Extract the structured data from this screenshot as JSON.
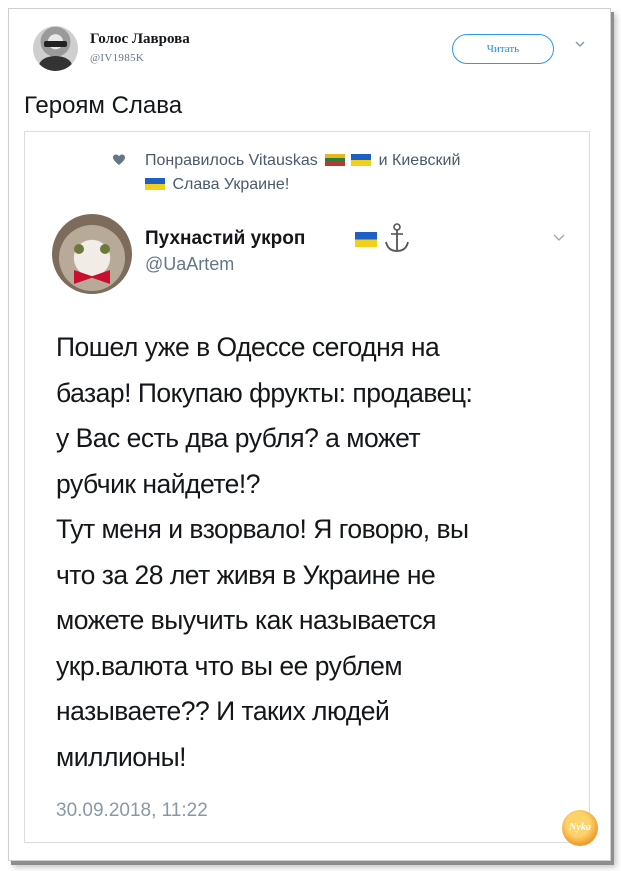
{
  "tweet": {
    "author_name": "Голос Лаврова",
    "author_handle": "@IV1985K",
    "follow_label": "Читать",
    "text": "Героям Слава"
  },
  "quoted": {
    "liked_line1_prefix": "Понравилось Vitauskas",
    "liked_line1_suffix": "и Киевский",
    "liked_line2": "Слава Украине!",
    "author_name": "Пухнастий укроп",
    "author_handle": "@UaArtem",
    "body": "Пошел уже в Одессе сегодня на\nбазар! Покупаю фрукты: продавец:\nу Вас есть два рубля? а может\nрубчик найдете!?\n  Тут меня и взорвало! Я говорю, вы\nчто за 28 лет живя в Украине не\nможете выучить как называется\nукр.валюта что вы ее рублем\nназываете?? И таких людей\nмиллионы!",
    "date": "30.09.2018, 11:22"
  },
  "watermark_text": "Nyka",
  "colors": {
    "follow": "#1d8fe0",
    "muted": "#657786",
    "date": "#8899a6",
    "flag_blue": "#1e5fc4",
    "flag_yellow": "#f2cf1a"
  },
  "icons": [
    "heart-icon",
    "chevron-down-icon",
    "anchor-icon",
    "flag-ua-icon",
    "flag-lt-icon"
  ]
}
